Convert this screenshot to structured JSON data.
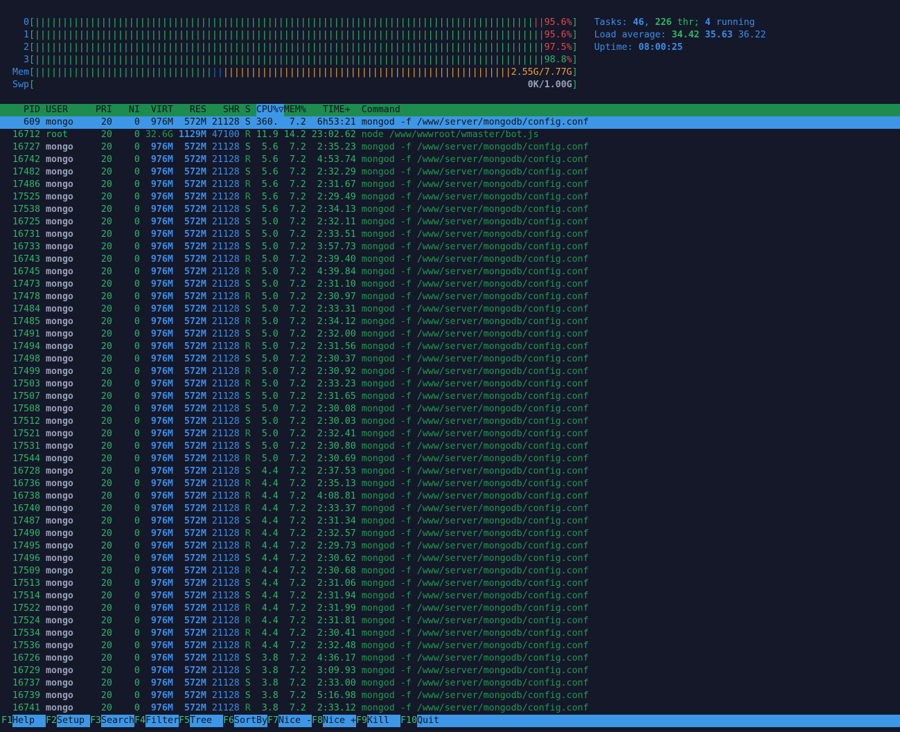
{
  "meters": {
    "cpus": [
      {
        "label": "0",
        "value": "95.6",
        "unit": "%",
        "value_color": "#e5484d",
        "user_pct": 97.8,
        "kernel_pct": 2.2
      },
      {
        "label": "1",
        "value": "95.6",
        "unit": "%",
        "value_color": "#e5484d",
        "user_pct": 98.9,
        "kernel_pct": 1.1
      },
      {
        "label": "2",
        "value": "97.5",
        "unit": "%",
        "value_color": "#e5484d",
        "user_pct": 100,
        "kernel_pct": 0
      },
      {
        "label": "3",
        "value": "98.8",
        "unit": "%",
        "value_color": "#2bb866",
        "user_pct": 100,
        "kernel_pct": 0
      }
    ],
    "mem": {
      "label": "Mem",
      "value": "2.55G/7.77G",
      "used_pct": 37,
      "buffers_pct": 2,
      "cache_pct": 60
    },
    "swap": {
      "label": "Swp",
      "value": "0K/1.00G",
      "used_pct": 0
    },
    "open_bracket": "[",
    "close_bracket": "]"
  },
  "summary": {
    "tasks_label": "Tasks: ",
    "tasks": "46",
    "sep1": ", ",
    "threads": "226",
    "thr_label": " thr; ",
    "running": "4",
    "running_label": " running",
    "load_label": "Load average: ",
    "load1": "34.42",
    "load5": "35.63",
    "load15": "36.22",
    "uptime_label": "Uptime: ",
    "uptime": "08:00:25"
  },
  "columns": {
    "pid": "PID",
    "user": "USER",
    "pri": "PRI",
    "ni": "NI",
    "virt": "VIRT",
    "res": "RES",
    "shr": "SHR",
    "s": "S",
    "cpu": "CPU%▽",
    "mem": "MEM%",
    "time": "TIME+",
    "command": "Command"
  },
  "selected_row": 0,
  "rows": [
    [
      "609",
      "mongo",
      "20",
      "0",
      "976M",
      "572M",
      "21128",
      "S",
      "360.",
      "7.2",
      "6h53:21",
      "mongod -f /www/server/mongodb/config.conf"
    ],
    [
      "16712",
      "root",
      "20",
      "0",
      "32.6G",
      "1129M",
      "47100",
      "R",
      "11.9",
      "14.2",
      "23:02.62",
      "node /www/wwwroot/wmaster/bot.js"
    ],
    [
      "16727",
      "mongo",
      "20",
      "0",
      "976M",
      "572M",
      "21128",
      "S",
      "5.6",
      "7.2",
      "2:35.23",
      "mongod -f /www/server/mongodb/config.conf"
    ],
    [
      "16742",
      "mongo",
      "20",
      "0",
      "976M",
      "572M",
      "21128",
      "R",
      "5.6",
      "7.2",
      "4:53.74",
      "mongod -f /www/server/mongodb/config.conf"
    ],
    [
      "17482",
      "mongo",
      "20",
      "0",
      "976M",
      "572M",
      "21128",
      "S",
      "5.6",
      "7.2",
      "2:32.29",
      "mongod -f /www/server/mongodb/config.conf"
    ],
    [
      "17486",
      "mongo",
      "20",
      "0",
      "976M",
      "572M",
      "21128",
      "R",
      "5.6",
      "7.2",
      "2:31.67",
      "mongod -f /www/server/mongodb/config.conf"
    ],
    [
      "17525",
      "mongo",
      "20",
      "0",
      "976M",
      "572M",
      "21128",
      "R",
      "5.6",
      "7.2",
      "2:29.49",
      "mongod -f /www/server/mongodb/config.conf"
    ],
    [
      "17538",
      "mongo",
      "20",
      "0",
      "976M",
      "572M",
      "21128",
      "S",
      "5.6",
      "7.2",
      "2:34.13",
      "mongod -f /www/server/mongodb/config.conf"
    ],
    [
      "16725",
      "mongo",
      "20",
      "0",
      "976M",
      "572M",
      "21128",
      "S",
      "5.0",
      "7.2",
      "2:32.11",
      "mongod -f /www/server/mongodb/config.conf"
    ],
    [
      "16731",
      "mongo",
      "20",
      "0",
      "976M",
      "572M",
      "21128",
      "S",
      "5.0",
      "7.2",
      "2:33.51",
      "mongod -f /www/server/mongodb/config.conf"
    ],
    [
      "16733",
      "mongo",
      "20",
      "0",
      "976M",
      "572M",
      "21128",
      "S",
      "5.0",
      "7.2",
      "3:57.73",
      "mongod -f /www/server/mongodb/config.conf"
    ],
    [
      "16743",
      "mongo",
      "20",
      "0",
      "976M",
      "572M",
      "21128",
      "R",
      "5.0",
      "7.2",
      "2:39.40",
      "mongod -f /www/server/mongodb/config.conf"
    ],
    [
      "16745",
      "mongo",
      "20",
      "0",
      "976M",
      "572M",
      "21128",
      "R",
      "5.0",
      "7.2",
      "4:39.84",
      "mongod -f /www/server/mongodb/config.conf"
    ],
    [
      "17473",
      "mongo",
      "20",
      "0",
      "976M",
      "572M",
      "21128",
      "S",
      "5.0",
      "7.2",
      "2:31.10",
      "mongod -f /www/server/mongodb/config.conf"
    ],
    [
      "17478",
      "mongo",
      "20",
      "0",
      "976M",
      "572M",
      "21128",
      "R",
      "5.0",
      "7.2",
      "2:30.97",
      "mongod -f /www/server/mongodb/config.conf"
    ],
    [
      "17484",
      "mongo",
      "20",
      "0",
      "976M",
      "572M",
      "21128",
      "S",
      "5.0",
      "7.2",
      "2:33.31",
      "mongod -f /www/server/mongodb/config.conf"
    ],
    [
      "17485",
      "mongo",
      "20",
      "0",
      "976M",
      "572M",
      "21128",
      "R",
      "5.0",
      "7.2",
      "2:34.12",
      "mongod -f /www/server/mongodb/config.conf"
    ],
    [
      "17491",
      "mongo",
      "20",
      "0",
      "976M",
      "572M",
      "21128",
      "S",
      "5.0",
      "7.2",
      "2:32.00",
      "mongod -f /www/server/mongodb/config.conf"
    ],
    [
      "17494",
      "mongo",
      "20",
      "0",
      "976M",
      "572M",
      "21128",
      "R",
      "5.0",
      "7.2",
      "2:31.56",
      "mongod -f /www/server/mongodb/config.conf"
    ],
    [
      "17498",
      "mongo",
      "20",
      "0",
      "976M",
      "572M",
      "21128",
      "S",
      "5.0",
      "7.2",
      "2:30.37",
      "mongod -f /www/server/mongodb/config.conf"
    ],
    [
      "17499",
      "mongo",
      "20",
      "0",
      "976M",
      "572M",
      "21128",
      "R",
      "5.0",
      "7.2",
      "2:30.92",
      "mongod -f /www/server/mongodb/config.conf"
    ],
    [
      "17503",
      "mongo",
      "20",
      "0",
      "976M",
      "572M",
      "21128",
      "R",
      "5.0",
      "7.2",
      "2:33.23",
      "mongod -f /www/server/mongodb/config.conf"
    ],
    [
      "17507",
      "mongo",
      "20",
      "0",
      "976M",
      "572M",
      "21128",
      "S",
      "5.0",
      "7.2",
      "2:31.65",
      "mongod -f /www/server/mongodb/config.conf"
    ],
    [
      "17508",
      "mongo",
      "20",
      "0",
      "976M",
      "572M",
      "21128",
      "S",
      "5.0",
      "7.2",
      "2:30.08",
      "mongod -f /www/server/mongodb/config.conf"
    ],
    [
      "17512",
      "mongo",
      "20",
      "0",
      "976M",
      "572M",
      "21128",
      "S",
      "5.0",
      "7.2",
      "2:30.03",
      "mongod -f /www/server/mongodb/config.conf"
    ],
    [
      "17521",
      "mongo",
      "20",
      "0",
      "976M",
      "572M",
      "21128",
      "R",
      "5.0",
      "7.2",
      "2:32.41",
      "mongod -f /www/server/mongodb/config.conf"
    ],
    [
      "17531",
      "mongo",
      "20",
      "0",
      "976M",
      "572M",
      "21128",
      "S",
      "5.0",
      "7.2",
      "2:30.80",
      "mongod -f /www/server/mongodb/config.conf"
    ],
    [
      "17544",
      "mongo",
      "20",
      "0",
      "976M",
      "572M",
      "21128",
      "R",
      "5.0",
      "7.2",
      "2:30.69",
      "mongod -f /www/server/mongodb/config.conf"
    ],
    [
      "16728",
      "mongo",
      "20",
      "0",
      "976M",
      "572M",
      "21128",
      "S",
      "4.4",
      "7.2",
      "2:37.53",
      "mongod -f /www/server/mongodb/config.conf"
    ],
    [
      "16736",
      "mongo",
      "20",
      "0",
      "976M",
      "572M",
      "21128",
      "R",
      "4.4",
      "7.2",
      "2:35.13",
      "mongod -f /www/server/mongodb/config.conf"
    ],
    [
      "16738",
      "mongo",
      "20",
      "0",
      "976M",
      "572M",
      "21128",
      "R",
      "4.4",
      "7.2",
      "4:08.81",
      "mongod -f /www/server/mongodb/config.conf"
    ],
    [
      "16740",
      "mongo",
      "20",
      "0",
      "976M",
      "572M",
      "21128",
      "R",
      "4.4",
      "7.2",
      "2:33.37",
      "mongod -f /www/server/mongodb/config.conf"
    ],
    [
      "17487",
      "mongo",
      "20",
      "0",
      "976M",
      "572M",
      "21128",
      "S",
      "4.4",
      "7.2",
      "2:31.34",
      "mongod -f /www/server/mongodb/config.conf"
    ],
    [
      "17490",
      "mongo",
      "20",
      "0",
      "976M",
      "572M",
      "21128",
      "R",
      "4.4",
      "7.2",
      "2:32.57",
      "mongod -f /www/server/mongodb/config.conf"
    ],
    [
      "17495",
      "mongo",
      "20",
      "0",
      "976M",
      "572M",
      "21128",
      "R",
      "4.4",
      "7.2",
      "2:29.73",
      "mongod -f /www/server/mongodb/config.conf"
    ],
    [
      "17496",
      "mongo",
      "20",
      "0",
      "976M",
      "572M",
      "21128",
      "S",
      "4.4",
      "7.2",
      "2:30.62",
      "mongod -f /www/server/mongodb/config.conf"
    ],
    [
      "17509",
      "mongo",
      "20",
      "0",
      "976M",
      "572M",
      "21128",
      "R",
      "4.4",
      "7.2",
      "2:30.68",
      "mongod -f /www/server/mongodb/config.conf"
    ],
    [
      "17513",
      "mongo",
      "20",
      "0",
      "976M",
      "572M",
      "21128",
      "S",
      "4.4",
      "7.2",
      "2:31.06",
      "mongod -f /www/server/mongodb/config.conf"
    ],
    [
      "17514",
      "mongo",
      "20",
      "0",
      "976M",
      "572M",
      "21128",
      "S",
      "4.4",
      "7.2",
      "2:31.94",
      "mongod -f /www/server/mongodb/config.conf"
    ],
    [
      "17522",
      "mongo",
      "20",
      "0",
      "976M",
      "572M",
      "21128",
      "R",
      "4.4",
      "7.2",
      "2:31.99",
      "mongod -f /www/server/mongodb/config.conf"
    ],
    [
      "17524",
      "mongo",
      "20",
      "0",
      "976M",
      "572M",
      "21128",
      "R",
      "4.4",
      "7.2",
      "2:31.81",
      "mongod -f /www/server/mongodb/config.conf"
    ],
    [
      "17534",
      "mongo",
      "20",
      "0",
      "976M",
      "572M",
      "21128",
      "R",
      "4.4",
      "7.2",
      "2:30.41",
      "mongod -f /www/server/mongodb/config.conf"
    ],
    [
      "17536",
      "mongo",
      "20",
      "0",
      "976M",
      "572M",
      "21128",
      "R",
      "4.4",
      "7.2",
      "2:32.48",
      "mongod -f /www/server/mongodb/config.conf"
    ],
    [
      "16726",
      "mongo",
      "20",
      "0",
      "976M",
      "572M",
      "21128",
      "S",
      "3.8",
      "7.2",
      "4:36.17",
      "mongod -f /www/server/mongodb/config.conf"
    ],
    [
      "16729",
      "mongo",
      "20",
      "0",
      "976M",
      "572M",
      "21128",
      "S",
      "3.8",
      "7.2",
      "3:09.93",
      "mongod -f /www/server/mongodb/config.conf"
    ],
    [
      "16737",
      "mongo",
      "20",
      "0",
      "976M",
      "572M",
      "21128",
      "S",
      "3.8",
      "7.2",
      "2:33.00",
      "mongod -f /www/server/mongodb/config.conf"
    ],
    [
      "16739",
      "mongo",
      "20",
      "0",
      "976M",
      "572M",
      "21128",
      "S",
      "3.8",
      "7.2",
      "5:16.98",
      "mongod -f /www/server/mongodb/config.conf"
    ],
    [
      "16741",
      "mongo",
      "20",
      "0",
      "976M",
      "572M",
      "21128",
      "R",
      "3.8",
      "7.2",
      "2:33.12",
      "mongod -f /www/server/mongodb/config.conf"
    ]
  ],
  "footer": [
    {
      "key": "F1",
      "label": "Help"
    },
    {
      "key": "F2",
      "label": "Setup"
    },
    {
      "key": "F3",
      "label": "Search"
    },
    {
      "key": "F4",
      "label": "Filter"
    },
    {
      "key": "F5",
      "label": "Tree"
    },
    {
      "key": "F6",
      "label": "SortBy"
    },
    {
      "key": "F7",
      "label": "Nice -"
    },
    {
      "key": "F8",
      "label": "Nice +"
    },
    {
      "key": "F9",
      "label": "Kill"
    },
    {
      "key": "F10",
      "label": "Quit"
    }
  ],
  "colors": {
    "background": "#141829",
    "green": "#2bb866",
    "blue": "#3b8eea",
    "selected": "#3d97e6",
    "header": "#1d8c4e",
    "red": "#e5484d",
    "orange": "#f0a030"
  }
}
